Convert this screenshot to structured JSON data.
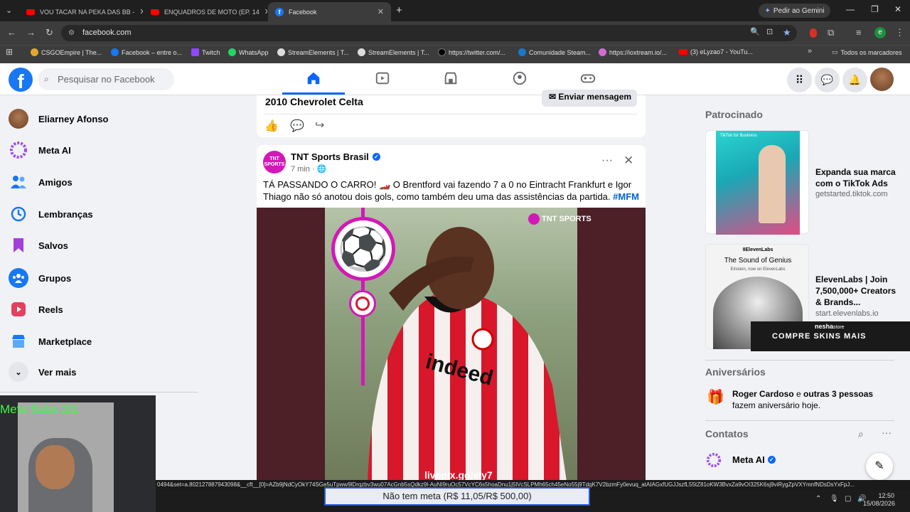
{
  "browser": {
    "tabs": [
      {
        "title": "VOU TACAR NA PEKA DAS BB -",
        "type": "youtube"
      },
      {
        "title": "ENQUADROS DE MOTO (EP. 14",
        "type": "youtube"
      },
      {
        "title": "Facebook",
        "type": "facebook",
        "active": true
      }
    ],
    "gemini_label": "Pedir ao Gemini",
    "url": "facebook.com",
    "bookmarks": [
      "CSGOEmpire | The...",
      "Facebook – entre o...",
      "Twitch",
      "WhatsApp",
      "StreamElements | T...",
      "StreamElements | T...",
      "https://twitter.com/...",
      "Comunidade Steam...",
      "https://ioxtream.io/...",
      "(3) eLyzao7 - YouTu..."
    ],
    "bookmarks_folder": "Todos os marcadores",
    "profile_initial": "e"
  },
  "fb": {
    "logo": "f",
    "search_placeholder": "Pesquisar no Facebook",
    "sidebar": [
      {
        "label": "Eliarney Afonso",
        "icon": "avatar",
        "color": "#7a4a2a"
      },
      {
        "label": "Meta AI",
        "icon": "meta-ai-icon",
        "color": "#a04ce8"
      },
      {
        "label": "Amigos",
        "icon": "friends-icon",
        "color": "#1877f2"
      },
      {
        "label": "Lembranças",
        "icon": "memories-icon",
        "color": "#1877f2"
      },
      {
        "label": "Salvos",
        "icon": "saved-icon",
        "color": "#a33fd6"
      },
      {
        "label": "Grupos",
        "icon": "groups-icon",
        "color": "#1877f2"
      },
      {
        "label": "Reels",
        "icon": "reels-icon",
        "color": "#e4405f"
      },
      {
        "label": "Marketplace",
        "icon": "marketplace-icon",
        "color": "#1877f2"
      },
      {
        "label": "Ver mais",
        "icon": "chevron-down-icon",
        "color": "#e4e6eb"
      }
    ],
    "prev_post": {
      "title": "2010 Chevrolet Celta",
      "send_label": "Enviar mensagem"
    },
    "post": {
      "author": "TNT Sports Brasil",
      "avatar_text": "TNT SPORTS",
      "time": "7 min",
      "text": "TÁ PASSANDO O CARRO! 🏎️ O Brentford vai fazendo 7 a 0 no Eintracht Frankfurt e Igor Thiago não só anotou dois gols, como também deu uma das assistências da partida.",
      "hashtag": "#MFM",
      "image_brand": "TNT SPORTS",
      "image_caption": "livepix.gg/ely7",
      "jersey_sponsor": "indeed"
    },
    "sponsored": {
      "header": "Patrocinado",
      "ads": [
        {
          "title": "Expanda sua marca com o TikTok Ads",
          "url": "getstarted.tiktok.com",
          "img_label": "TikTok for Business"
        },
        {
          "title": "ElevenLabs | Join 7,500,000+ Creators & Brands...",
          "url": "start.elevenlabs.io",
          "img_brand": "IIElevenLabs",
          "img_title": "The Sound of Genius",
          "img_sub": "Einstein, now on ElevenLabs"
        }
      ]
    },
    "birthdays": {
      "header": "Aniversários",
      "name": "Roger Cardoso",
      "connector": " e ",
      "others": "outras 3 pessoas",
      "suffix": " fazem aniversário hoje."
    },
    "contacts": {
      "header": "Contatos",
      "first": "Meta AI"
    }
  },
  "overlay": {
    "webcam_text": "Meta Subs 2/1",
    "url_strip": "0494&set=a.802127887943098&__cft__[0]=AZb9jNdCyOkY74SGe5uTpww9lDrqzbv3wu07AcGnb5sQdkz9l-AuNI9ruOc57VcYC6s5hoaDnu1j5lVcSLPMh65ch45eNo55j9TdqK7V2bzmFy0evuq_atAIAGxfUGJJszfL55tZ81oKW3BvxZa9vOI325K6sj9viRygZpVXYmnfNDsDsYxFpJ...",
    "meta_label": "Não tem meta (R$ 11,05/R$ 500,00)",
    "nesha_brand": "nesha",
    "nesha_suffix": "store",
    "nesha_text": "COMPRE SKINS MAIS",
    "clock_time": "12:50",
    "clock_date": "15/08/2026"
  }
}
